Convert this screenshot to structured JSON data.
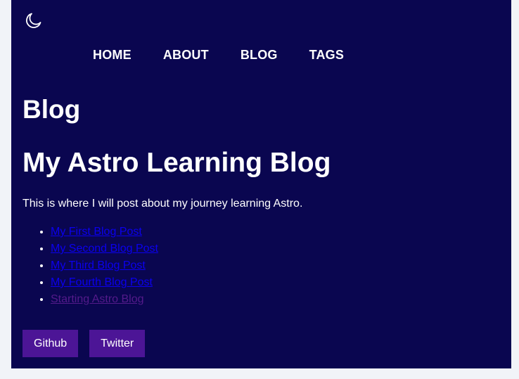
{
  "theme_toggle": {
    "icon": "moon-icon"
  },
  "nav": {
    "items": [
      {
        "label": "HOME"
      },
      {
        "label": "ABOUT"
      },
      {
        "label": "BLOG"
      },
      {
        "label": "TAGS"
      }
    ]
  },
  "page_heading": "Blog",
  "blog": {
    "title": "My Astro Learning Blog",
    "intro": "This is where I will post about my journey learning Astro.",
    "posts": [
      {
        "label": "My First Blog Post"
      },
      {
        "label": "My Second Blog Post"
      },
      {
        "label": "My Third Blog Post"
      },
      {
        "label": "My Fourth Blog Post"
      },
      {
        "label": "Starting Astro Blog"
      }
    ]
  },
  "footer": {
    "social": [
      {
        "label": "Github"
      },
      {
        "label": "Twitter"
      }
    ]
  },
  "colors": {
    "page_background": "#0a0650",
    "outer_background": "#f1f3f8",
    "link": "#0b00ee",
    "visited_link": "#541a8b",
    "button": "#4c1596"
  }
}
